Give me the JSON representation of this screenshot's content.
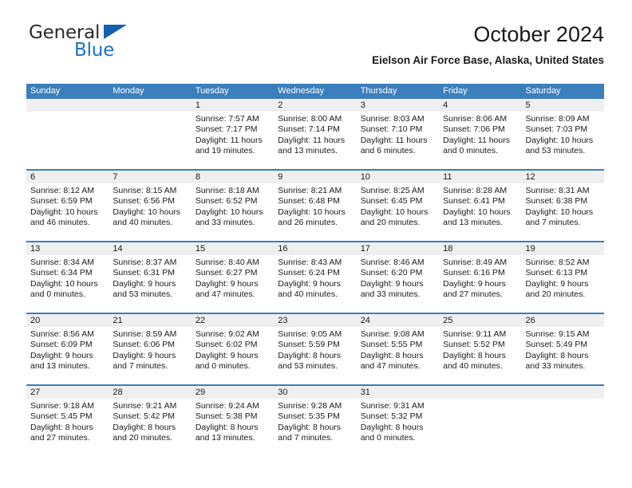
{
  "brand": {
    "name_part1": "General",
    "name_part2": "Blue",
    "triangle_icon": "triangle-icon",
    "colors": {
      "dark_text": "#2b2b2b",
      "blue_text": "#1a6fc4",
      "triangle": "#1161ad"
    }
  },
  "header": {
    "title": "October 2024",
    "subtitle": "Eielson Air Force Base, Alaska, United States"
  },
  "calendar": {
    "accent_header_bg": "#3b7fbd",
    "daynum_bg": "#efefef",
    "weekdays": [
      "Sunday",
      "Monday",
      "Tuesday",
      "Wednesday",
      "Thursday",
      "Friday",
      "Saturday"
    ],
    "weeks": [
      [
        {
          "day": "",
          "lines": []
        },
        {
          "day": "",
          "lines": []
        },
        {
          "day": "1",
          "lines": [
            "Sunrise: 7:57 AM",
            "Sunset: 7:17 PM",
            "Daylight: 11 hours",
            "and 19 minutes."
          ]
        },
        {
          "day": "2",
          "lines": [
            "Sunrise: 8:00 AM",
            "Sunset: 7:14 PM",
            "Daylight: 11 hours",
            "and 13 minutes."
          ]
        },
        {
          "day": "3",
          "lines": [
            "Sunrise: 8:03 AM",
            "Sunset: 7:10 PM",
            "Daylight: 11 hours",
            "and 6 minutes."
          ]
        },
        {
          "day": "4",
          "lines": [
            "Sunrise: 8:06 AM",
            "Sunset: 7:06 PM",
            "Daylight: 11 hours",
            "and 0 minutes."
          ]
        },
        {
          "day": "5",
          "lines": [
            "Sunrise: 8:09 AM",
            "Sunset: 7:03 PM",
            "Daylight: 10 hours",
            "and 53 minutes."
          ]
        }
      ],
      [
        {
          "day": "6",
          "lines": [
            "Sunrise: 8:12 AM",
            "Sunset: 6:59 PM",
            "Daylight: 10 hours",
            "and 46 minutes."
          ]
        },
        {
          "day": "7",
          "lines": [
            "Sunrise: 8:15 AM",
            "Sunset: 6:56 PM",
            "Daylight: 10 hours",
            "and 40 minutes."
          ]
        },
        {
          "day": "8",
          "lines": [
            "Sunrise: 8:18 AM",
            "Sunset: 6:52 PM",
            "Daylight: 10 hours",
            "and 33 minutes."
          ]
        },
        {
          "day": "9",
          "lines": [
            "Sunrise: 8:21 AM",
            "Sunset: 6:48 PM",
            "Daylight: 10 hours",
            "and 26 minutes."
          ]
        },
        {
          "day": "10",
          "lines": [
            "Sunrise: 8:25 AM",
            "Sunset: 6:45 PM",
            "Daylight: 10 hours",
            "and 20 minutes."
          ]
        },
        {
          "day": "11",
          "lines": [
            "Sunrise: 8:28 AM",
            "Sunset: 6:41 PM",
            "Daylight: 10 hours",
            "and 13 minutes."
          ]
        },
        {
          "day": "12",
          "lines": [
            "Sunrise: 8:31 AM",
            "Sunset: 6:38 PM",
            "Daylight: 10 hours",
            "and 7 minutes."
          ]
        }
      ],
      [
        {
          "day": "13",
          "lines": [
            "Sunrise: 8:34 AM",
            "Sunset: 6:34 PM",
            "Daylight: 10 hours",
            "and 0 minutes."
          ]
        },
        {
          "day": "14",
          "lines": [
            "Sunrise: 8:37 AM",
            "Sunset: 6:31 PM",
            "Daylight: 9 hours",
            "and 53 minutes."
          ]
        },
        {
          "day": "15",
          "lines": [
            "Sunrise: 8:40 AM",
            "Sunset: 6:27 PM",
            "Daylight: 9 hours",
            "and 47 minutes."
          ]
        },
        {
          "day": "16",
          "lines": [
            "Sunrise: 8:43 AM",
            "Sunset: 6:24 PM",
            "Daylight: 9 hours",
            "and 40 minutes."
          ]
        },
        {
          "day": "17",
          "lines": [
            "Sunrise: 8:46 AM",
            "Sunset: 6:20 PM",
            "Daylight: 9 hours",
            "and 33 minutes."
          ]
        },
        {
          "day": "18",
          "lines": [
            "Sunrise: 8:49 AM",
            "Sunset: 6:16 PM",
            "Daylight: 9 hours",
            "and 27 minutes."
          ]
        },
        {
          "day": "19",
          "lines": [
            "Sunrise: 8:52 AM",
            "Sunset: 6:13 PM",
            "Daylight: 9 hours",
            "and 20 minutes."
          ]
        }
      ],
      [
        {
          "day": "20",
          "lines": [
            "Sunrise: 8:56 AM",
            "Sunset: 6:09 PM",
            "Daylight: 9 hours",
            "and 13 minutes."
          ]
        },
        {
          "day": "21",
          "lines": [
            "Sunrise: 8:59 AM",
            "Sunset: 6:06 PM",
            "Daylight: 9 hours",
            "and 7 minutes."
          ]
        },
        {
          "day": "22",
          "lines": [
            "Sunrise: 9:02 AM",
            "Sunset: 6:02 PM",
            "Daylight: 9 hours",
            "and 0 minutes."
          ]
        },
        {
          "day": "23",
          "lines": [
            "Sunrise: 9:05 AM",
            "Sunset: 5:59 PM",
            "Daylight: 8 hours",
            "and 53 minutes."
          ]
        },
        {
          "day": "24",
          "lines": [
            "Sunrise: 9:08 AM",
            "Sunset: 5:55 PM",
            "Daylight: 8 hours",
            "and 47 minutes."
          ]
        },
        {
          "day": "25",
          "lines": [
            "Sunrise: 9:11 AM",
            "Sunset: 5:52 PM",
            "Daylight: 8 hours",
            "and 40 minutes."
          ]
        },
        {
          "day": "26",
          "lines": [
            "Sunrise: 9:15 AM",
            "Sunset: 5:49 PM",
            "Daylight: 8 hours",
            "and 33 minutes."
          ]
        }
      ],
      [
        {
          "day": "27",
          "lines": [
            "Sunrise: 9:18 AM",
            "Sunset: 5:45 PM",
            "Daylight: 8 hours",
            "and 27 minutes."
          ]
        },
        {
          "day": "28",
          "lines": [
            "Sunrise: 9:21 AM",
            "Sunset: 5:42 PM",
            "Daylight: 8 hours",
            "and 20 minutes."
          ]
        },
        {
          "day": "29",
          "lines": [
            "Sunrise: 9:24 AM",
            "Sunset: 5:38 PM",
            "Daylight: 8 hours",
            "and 13 minutes."
          ]
        },
        {
          "day": "30",
          "lines": [
            "Sunrise: 9:28 AM",
            "Sunset: 5:35 PM",
            "Daylight: 8 hours",
            "and 7 minutes."
          ]
        },
        {
          "day": "31",
          "lines": [
            "Sunrise: 9:31 AM",
            "Sunset: 5:32 PM",
            "Daylight: 8 hours",
            "and 0 minutes."
          ]
        },
        {
          "day": "",
          "lines": []
        },
        {
          "day": "",
          "lines": []
        }
      ]
    ]
  }
}
